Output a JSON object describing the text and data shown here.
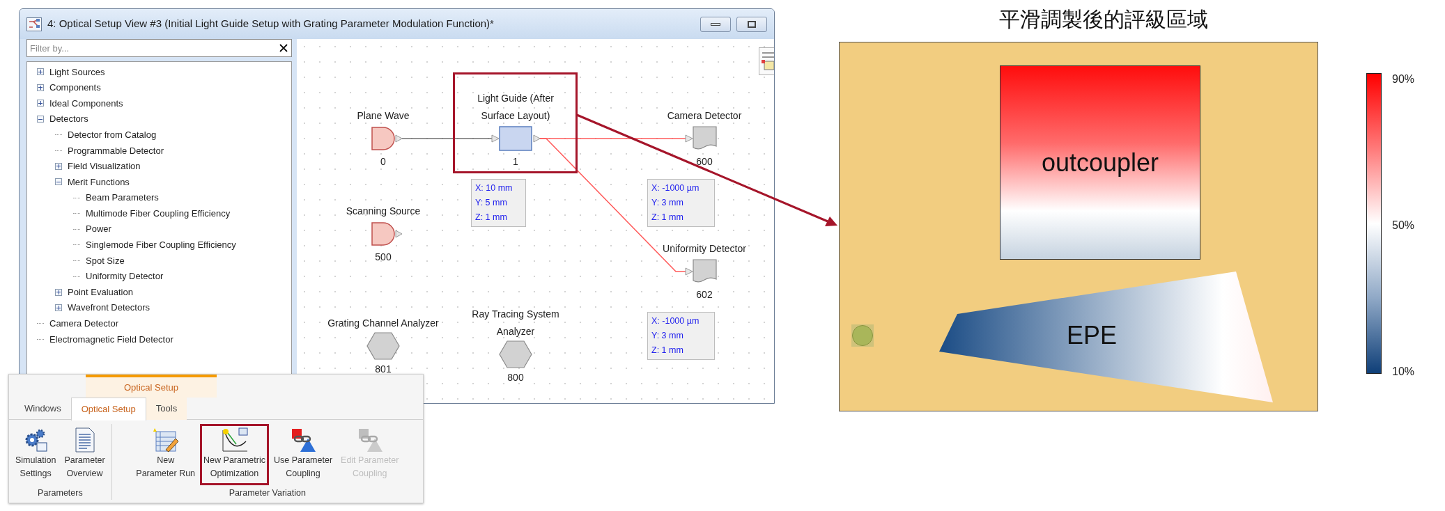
{
  "window": {
    "title": "4: Optical Setup View #3 (Initial Light Guide Setup with Grating Parameter Modulation Function)*"
  },
  "filter": {
    "placeholder": "Filter by..."
  },
  "tree": [
    {
      "kind": "group",
      "label": "Light Sources",
      "expanded": false
    },
    {
      "kind": "group",
      "label": "Components",
      "expanded": false
    },
    {
      "kind": "group",
      "label": "Ideal Components",
      "expanded": false
    },
    {
      "kind": "group",
      "label": "Detectors",
      "expanded": true,
      "children": [
        {
          "kind": "item",
          "label": "Detector from Catalog"
        },
        {
          "kind": "item",
          "label": "Programmable Detector"
        },
        {
          "kind": "group",
          "label": "Field Visualization",
          "expanded": false
        },
        {
          "kind": "group",
          "label": "Merit Functions",
          "expanded": true,
          "children": [
            {
              "kind": "item",
              "label": "Beam Parameters"
            },
            {
              "kind": "item",
              "label": "Multimode Fiber Coupling Efficiency"
            },
            {
              "kind": "item",
              "label": "Power"
            },
            {
              "kind": "item",
              "label": "Singlemode Fiber Coupling Efficiency"
            },
            {
              "kind": "item",
              "label": "Spot Size"
            },
            {
              "kind": "item",
              "label": "Uniformity Detector"
            }
          ]
        },
        {
          "kind": "group",
          "label": "Point Evaluation",
          "expanded": false
        },
        {
          "kind": "group",
          "label": "Wavefront Detectors",
          "expanded": false
        }
      ]
    },
    {
      "kind": "item",
      "label": "Camera Detector"
    },
    {
      "kind": "item",
      "label": "Electromagnetic Field Detector"
    }
  ],
  "nodes": [
    {
      "kind": "source",
      "label": "Plane Wave",
      "number": "0",
      "highlighted": false
    },
    {
      "kind": "component",
      "label": "Light Guide (After Surface Layout)",
      "number": "1",
      "highlighted": true,
      "position": [
        "X: 10 mm",
        "Y: 5 mm",
        "Z: 1 mm"
      ]
    },
    {
      "kind": "detector",
      "label": "Camera Detector",
      "number": "600",
      "highlighted": false,
      "position": [
        "X: -1000 µm",
        "Y: 3 mm",
        "Z: 1 mm"
      ]
    },
    {
      "kind": "detector",
      "label": "Uniformity Detector",
      "number": "602",
      "highlighted": false,
      "position": [
        "X: -1000 µm",
        "Y: 3 mm",
        "Z: 1 mm"
      ]
    },
    {
      "kind": "source",
      "label": "Scanning Source",
      "number": "500",
      "highlighted": false
    },
    {
      "kind": "analyzer",
      "label": "Grating Channel Analyzer",
      "number": "801",
      "highlighted": false
    },
    {
      "kind": "analyzer",
      "label": "Ray Tracing System Analyzer",
      "number": "800",
      "highlighted": false
    }
  ],
  "ribbon": {
    "context_label": "Optical Setup",
    "tabs": [
      {
        "label": "Windows",
        "selected": false
      },
      {
        "label": "Optical Setup",
        "selected": true
      },
      {
        "label": "Tools",
        "selected": false
      }
    ],
    "groups": [
      {
        "label": "Parameters",
        "buttons": [
          {
            "kind": "gears",
            "lines": [
              "Simulation",
              "Settings"
            ],
            "disabled": false,
            "highlighted": false
          },
          {
            "kind": "document",
            "lines": [
              "Parameter",
              "Overview"
            ],
            "disabled": false,
            "highlighted": false
          }
        ]
      },
      {
        "label": "Parameter Variation",
        "buttons": [
          {
            "kind": "run",
            "lines": [
              "New",
              "Parameter Run"
            ],
            "disabled": false,
            "highlighted": false
          },
          {
            "kind": "optimization",
            "lines": [
              "New Parametric",
              "Optimization"
            ],
            "disabled": false,
            "highlighted": true
          },
          {
            "kind": "coupling",
            "lines": [
              "Use Parameter",
              "Coupling"
            ],
            "disabled": false,
            "highlighted": false
          },
          {
            "kind": "coupling",
            "lines": [
              "Edit Parameter",
              "Coupling"
            ],
            "disabled": true,
            "highlighted": false
          }
        ]
      }
    ]
  },
  "figure": {
    "title": "平滑調製後的評級區域",
    "regions": [
      {
        "kind": "rect",
        "label": "outcoupler"
      },
      {
        "kind": "wedge",
        "label": "EPE"
      }
    ],
    "colorbar": {
      "ticks": [
        "90%",
        "50%",
        "10%"
      ]
    }
  }
}
